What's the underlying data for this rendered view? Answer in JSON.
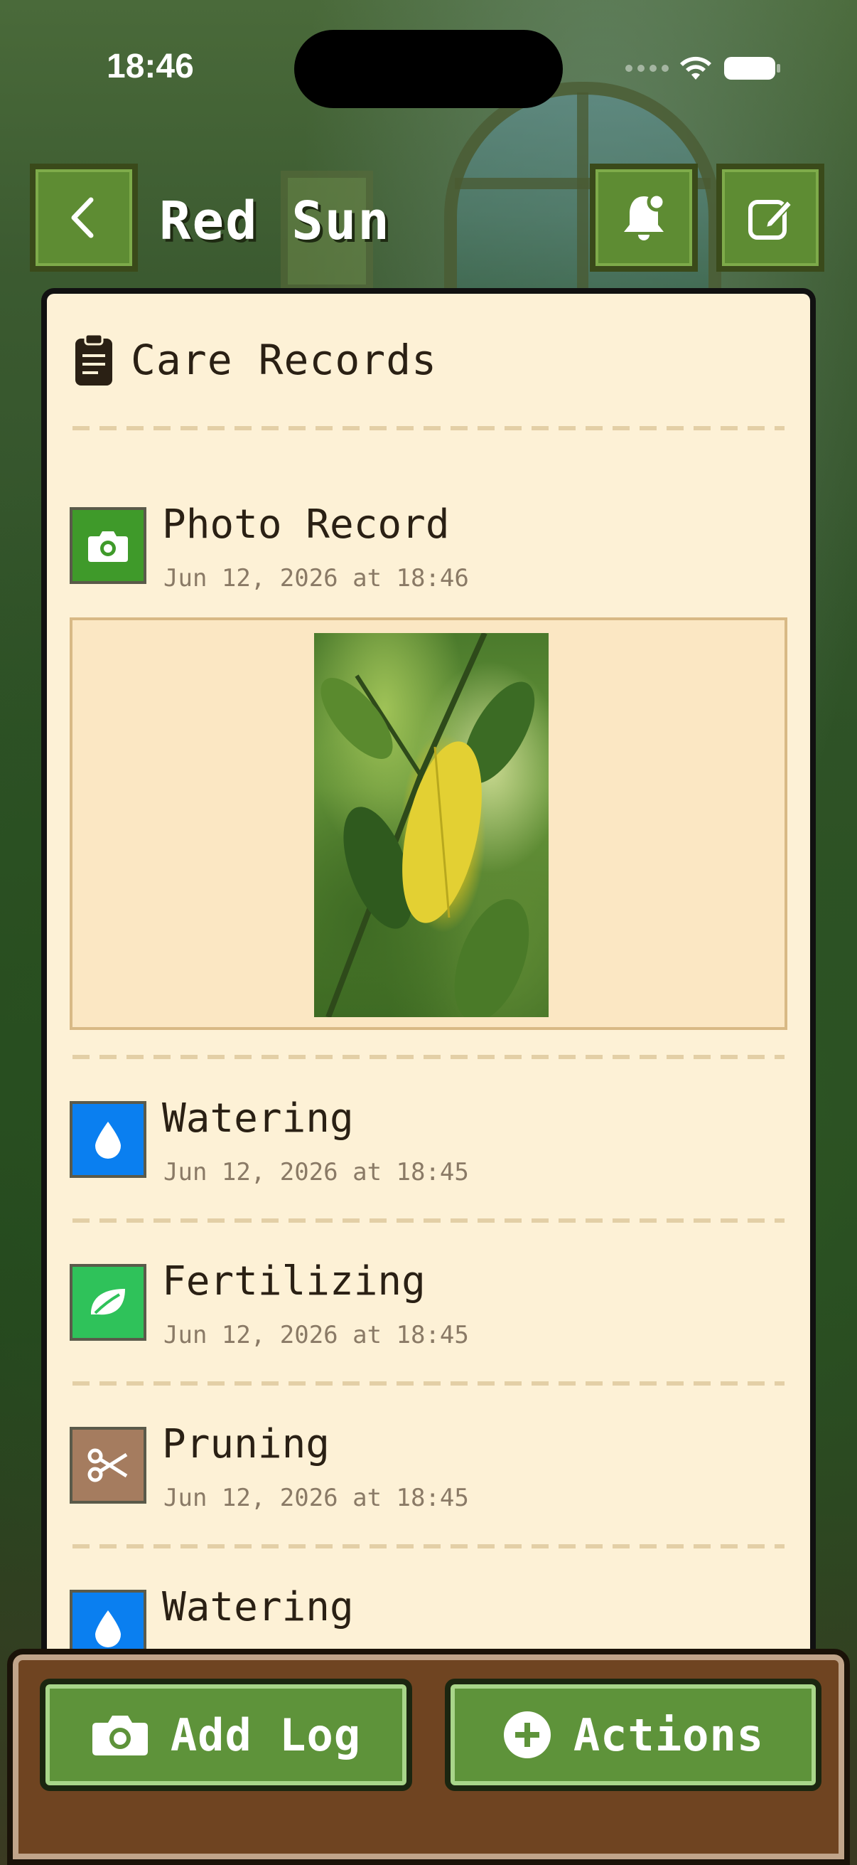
{
  "status": {
    "time": "18:46"
  },
  "header": {
    "title": "Red Sun"
  },
  "card": {
    "title": "Care Records"
  },
  "records": [
    {
      "title": "Photo Record",
      "date": "Jun 12, 2026 at 18:46",
      "icon": "camera-icon",
      "color": "#3f9a2a"
    },
    {
      "title": "Watering",
      "date": "Jun 12, 2026 at 18:45",
      "icon": "water-drop-icon",
      "color": "#0a7ff0"
    },
    {
      "title": "Fertilizing",
      "date": "Jun 12, 2026 at 18:45",
      "icon": "leaf-icon",
      "color": "#2fc25a"
    },
    {
      "title": "Pruning",
      "date": "Jun 12, 2026 at 18:45",
      "icon": "scissors-icon",
      "color": "#a57c5f"
    },
    {
      "title": "Watering",
      "date": "",
      "icon": "water-drop-icon",
      "color": "#0a7ff0"
    }
  ],
  "bottom": {
    "add_log": "Add Log",
    "actions": "Actions"
  }
}
